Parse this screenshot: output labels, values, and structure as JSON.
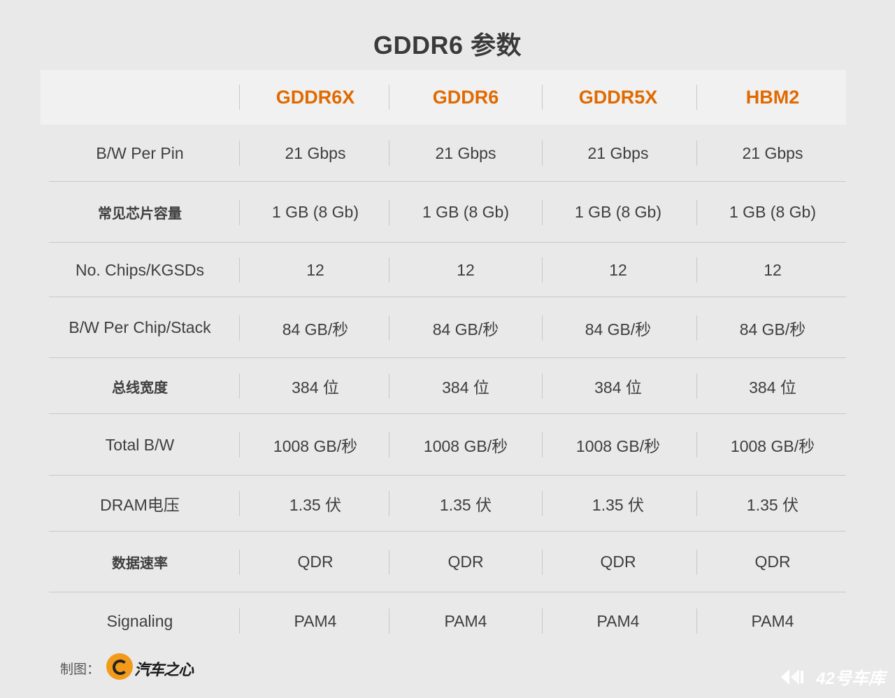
{
  "title": "GDDR6 参数",
  "columns": [
    "GDDR6X",
    "GDDR6",
    "GDDR5X",
    "HBM2"
  ],
  "rows": [
    {
      "label": "B/W Per Pin",
      "cjk": false,
      "height": 82,
      "values": [
        "21 Gbps",
        "21 Gbps",
        "21 Gbps",
        "21 Gbps"
      ]
    },
    {
      "label": "常见芯片容量",
      "cjk": true,
      "height": 87,
      "values": [
        "1 GB (8 Gb)",
        "1 GB (8 Gb)",
        "1 GB (8 Gb)",
        "1 GB (8 Gb)"
      ]
    },
    {
      "label": "No. Chips/KGSDs",
      "cjk": false,
      "height": 78,
      "values": [
        "12",
        "12",
        "12",
        "12"
      ]
    },
    {
      "label": "B/W Per Chip/Stack",
      "cjk": false,
      "height": 87,
      "values": [
        "84 GB/秒",
        "84 GB/秒",
        "84 GB/秒",
        "84 GB/秒"
      ]
    },
    {
      "label": "总线宽度",
      "cjk": true,
      "height": 80,
      "values": [
        "384 位",
        "384 位",
        "384 位",
        "384 位"
      ]
    },
    {
      "label": "Total B/W",
      "cjk": false,
      "height": 88,
      "values": [
        "1008 GB/秒",
        "1008 GB/秒",
        "1008 GB/秒",
        "1008 GB/秒"
      ]
    },
    {
      "label": "DRAM电压",
      "cjk": false,
      "height": 80,
      "values": [
        "1.35 伏",
        "1.35 伏",
        "1.35 伏",
        "1.35 伏"
      ]
    },
    {
      "label": "数据速率",
      "cjk": true,
      "height": 87,
      "values": [
        "QDR",
        "QDR",
        "QDR",
        "QDR"
      ]
    },
    {
      "label": "Signaling",
      "cjk": false,
      "height": 82,
      "values": [
        "PAM4",
        "PAM4",
        "PAM4",
        "PAM4"
      ],
      "last": true
    }
  ],
  "footer": {
    "label": "制图：",
    "brand": "汽车之心",
    "watermark": "42号车库"
  }
}
